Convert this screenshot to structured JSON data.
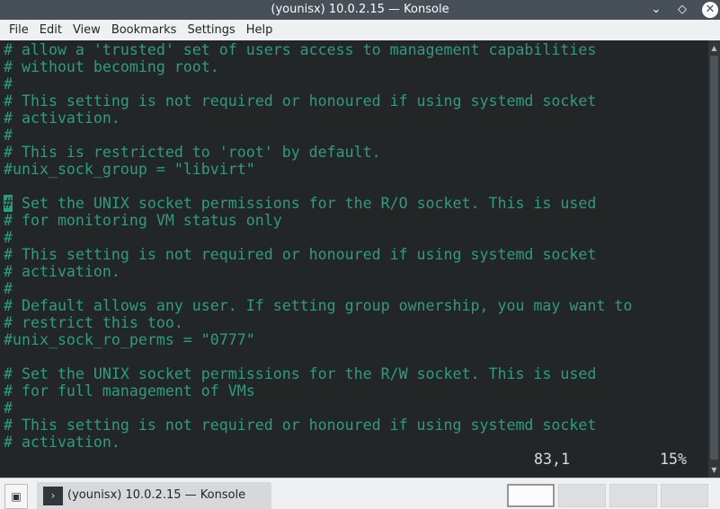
{
  "window": {
    "title": "(younisx) 10.0.2.15 — Konsole"
  },
  "menu": [
    "File",
    "Edit",
    "View",
    "Bookmarks",
    "Settings",
    "Help"
  ],
  "terminal": {
    "lines": [
      "# allow a 'trusted' set of users access to management capabilities",
      "# without becoming root.",
      "#",
      "# This setting is not required or honoured if using systemd socket",
      "# activation.",
      "#",
      "# This is restricted to 'root' by default.",
      "#unix_sock_group = \"libvirt\"",
      "",
      "# Set the UNIX socket permissions for the R/O socket. This is used",
      "# for monitoring VM status only",
      "#",
      "# This setting is not required or honoured if using systemd socket",
      "# activation.",
      "#",
      "# Default allows any user. If setting group ownership, you may want to",
      "# restrict this too.",
      "#unix_sock_ro_perms = \"0777\"",
      "",
      "# Set the UNIX socket permissions for the R/W socket. This is used",
      "# for full management of VMs",
      "#",
      "# This setting is not required or honoured if using systemd socket",
      "# activation."
    ],
    "cursor_line": 9,
    "status_position": "83,1",
    "status_percent": "15%"
  },
  "colors": {
    "text": "#2a9d82",
    "background": "#232627",
    "titlebar": "#475057"
  },
  "taskbar": {
    "task_label": "(younisx) 10.0.2.15 — Konsole",
    "pagers": 4,
    "active_pager": 0
  }
}
